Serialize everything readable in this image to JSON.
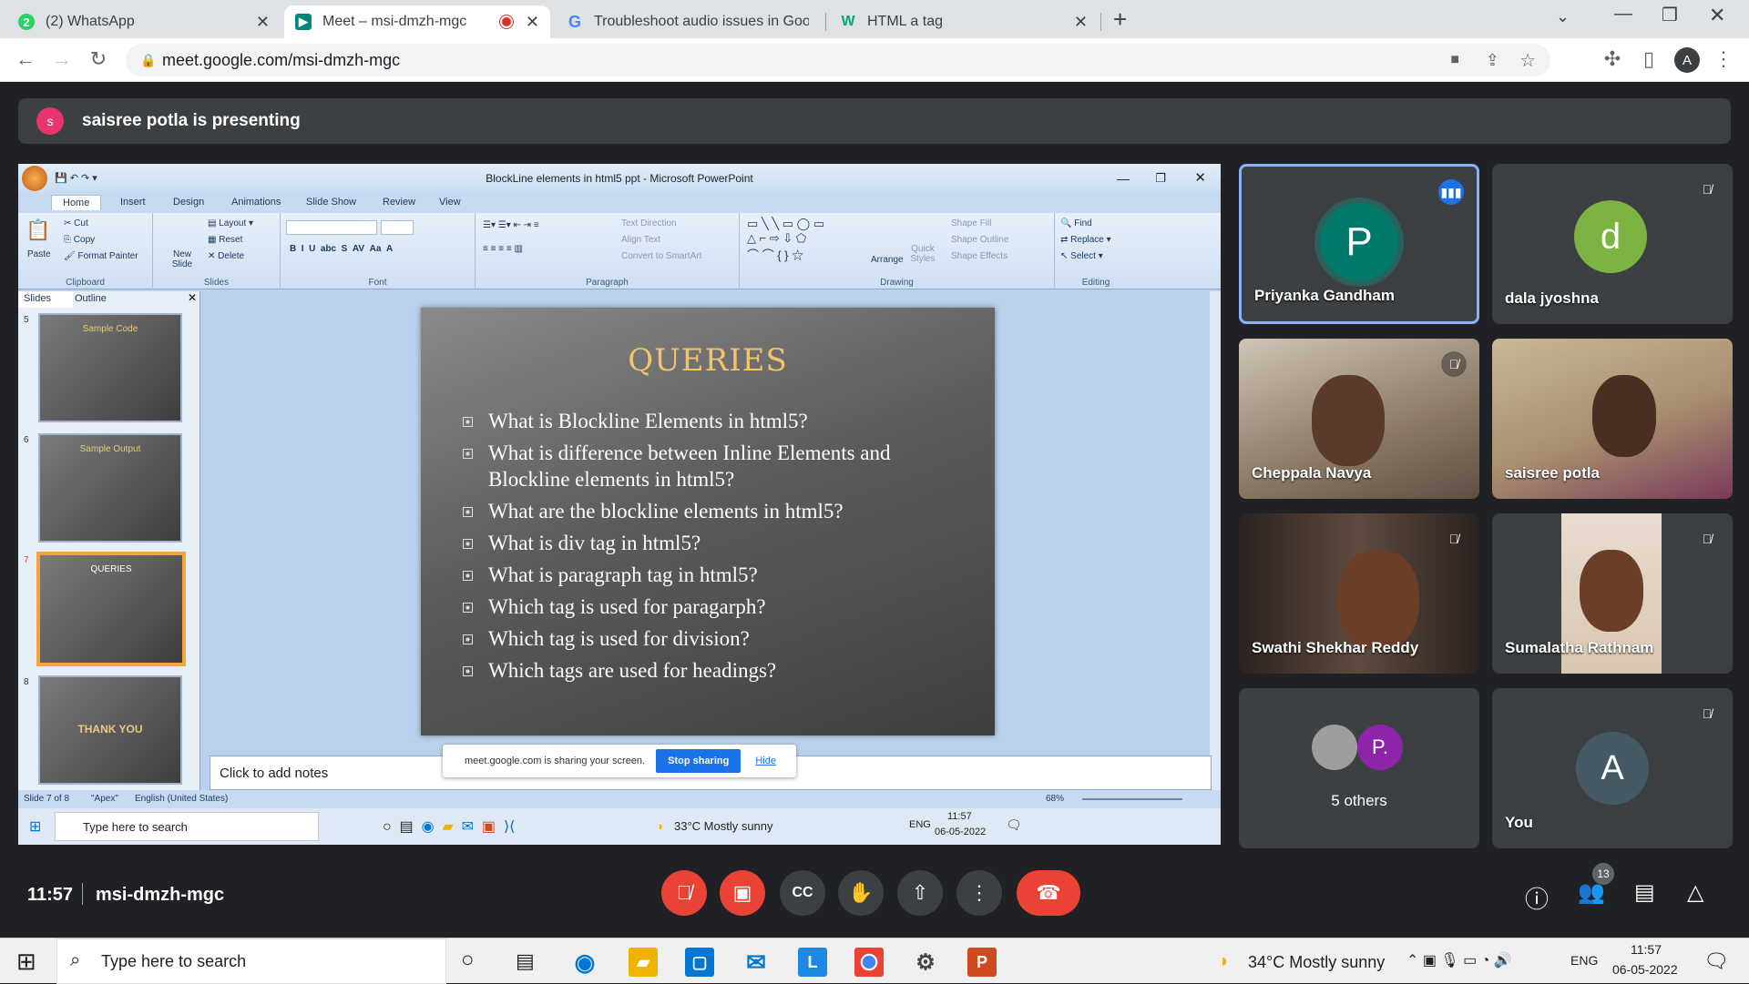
{
  "browser": {
    "tabs": [
      {
        "label": "(2) WhatsApp",
        "icon": "whatsapp-icon"
      },
      {
        "label": "Meet – msi-dmzh-mgc",
        "icon": "meet-icon"
      },
      {
        "label": "Troubleshoot audio issues in Goo",
        "icon": "google-icon"
      },
      {
        "label": "HTML a tag",
        "icon": "w3schools-icon"
      }
    ],
    "url": "meet.google.com/msi-dmzh-mgc",
    "profile": "A"
  },
  "meet": {
    "presenting": "saisree potla is presenting",
    "presenter_initial": "s",
    "time": "11:57",
    "meeting_code": "msi-dmzh-mgc",
    "people_count": "13"
  },
  "ppt": {
    "window_title": "BlockLine elements in html5 ppt - Microsoft PowerPoint",
    "tabs": [
      "Home",
      "Insert",
      "Design",
      "Animations",
      "Slide Show",
      "Review",
      "View"
    ],
    "clipboard": {
      "paste": "Paste",
      "cut": "Cut",
      "copy": "Copy",
      "format": "Format Painter",
      "label": "Clipboard"
    },
    "slides_group": {
      "new": "New Slide",
      "layout": "Layout",
      "reset": "Reset",
      "delete": "Delete",
      "label": "Slides"
    },
    "font_label": "Font",
    "paragraph": {
      "dir": "Text Direction",
      "align": "Align Text",
      "smart": "Convert to SmartArt",
      "label": "Paragraph"
    },
    "drawing": {
      "arrange": "Arrange",
      "quick": "Quick Styles",
      "fill": "Shape Fill",
      "outline": "Shape Outline",
      "effects": "Shape Effects",
      "label": "Drawing"
    },
    "editing": {
      "find": "Find",
      "replace": "Replace",
      "select": "Select",
      "label": "Editing"
    },
    "pane_tabs": [
      "Slides",
      "Outline"
    ],
    "thumbs": [
      {
        "num": "5",
        "title": "Sample Code"
      },
      {
        "num": "6",
        "title": "Sample Output"
      },
      {
        "num": "7",
        "title": "QUERIES"
      },
      {
        "num": "8",
        "title": "THANK YOU"
      }
    ],
    "slide": {
      "title": "QUERIES",
      "bullets": [
        "What is Blockline Elements in html5?",
        "What is difference between Inline Elements and Blockline elements in html5?",
        "What are the blockline elements in html5?",
        "What is div tag in html5?",
        "What is paragraph tag in html5?",
        "Which tag is used for paragarph?",
        "Which tag is used for division?",
        "Which tags are used for headings?"
      ]
    },
    "notes": "Click to add notes",
    "status": {
      "slide": "Slide 7 of 8",
      "theme": "\"Apex\"",
      "lang": "English (United States)",
      "zoom": "68%"
    },
    "share_msg": "meet.google.com is sharing your screen.",
    "stop_sharing": "Stop sharing",
    "hide": "Hide"
  },
  "inner_taskbar": {
    "search": "Type here to search",
    "weather": "33°C  Mostly sunny",
    "lang": "ENG",
    "time": "11:57",
    "date": "06-05-2022"
  },
  "participants": [
    {
      "name": "Priyanka Gandham",
      "initial": "P",
      "color": "#00796b"
    },
    {
      "name": "dala jyoshna",
      "initial": "d",
      "color": "#7cb342"
    },
    {
      "name": "Cheppala Navya"
    },
    {
      "name": "saisree potla"
    },
    {
      "name": "Swathi Shekhar Reddy"
    },
    {
      "name": "Sumalatha Rathnam"
    },
    {
      "name": "5 others",
      "initial": "P."
    },
    {
      "name": "You",
      "initial": "A",
      "color": "#455a64"
    }
  ],
  "taskbar": {
    "search": "Type here to search",
    "weather": "34°C  Mostly sunny",
    "lang": "ENG",
    "time": "11:57",
    "date": "06-05-2022"
  }
}
